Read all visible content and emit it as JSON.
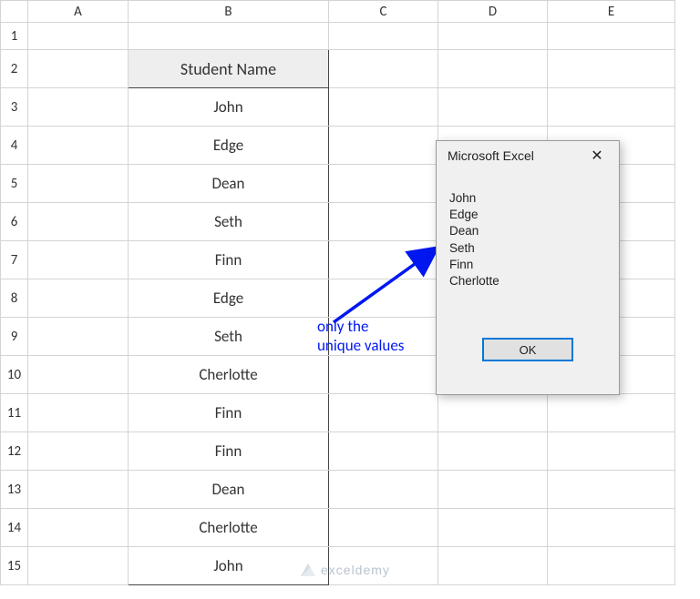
{
  "columns": [
    "A",
    "B",
    "C",
    "D",
    "E"
  ],
  "rows": [
    "1",
    "2",
    "3",
    "4",
    "5",
    "6",
    "7",
    "8",
    "9",
    "10",
    "11",
    "12",
    "13",
    "14",
    "15"
  ],
  "b2_header": "Student Name",
  "b_values": [
    "John",
    "Edge",
    "Dean",
    "Seth",
    "Finn",
    "Edge",
    "Seth",
    "Cherlotte",
    "Finn",
    "Finn",
    "Dean",
    "Cherlotte",
    "John"
  ],
  "dialog": {
    "title": "Microsoft Excel",
    "close_glyph": "✕",
    "lines": [
      "John",
      "Edge",
      "Dean",
      "Seth",
      "Finn",
      "Cherlotte"
    ],
    "ok": "OK"
  },
  "annotation": {
    "line1": "only the",
    "line2": "unique values"
  },
  "watermark": "exceldemy"
}
